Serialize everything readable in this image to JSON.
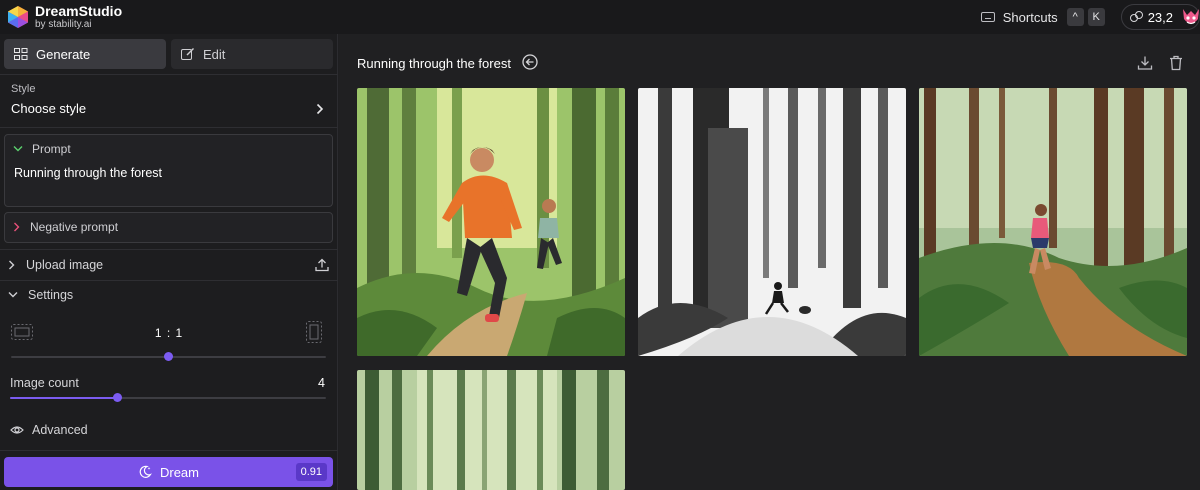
{
  "header": {
    "app_name": "DreamStudio",
    "app_sub": "by stability.ai",
    "shortcuts_label": "Shortcuts",
    "shortcut_keys": [
      "^",
      "K"
    ],
    "credits": "23,2"
  },
  "sidebar": {
    "tabs": [
      {
        "label": "Generate",
        "icon": "grid-icon",
        "active": true
      },
      {
        "label": "Edit",
        "icon": "edit-icon",
        "active": false
      }
    ],
    "style": {
      "label": "Style",
      "value": "Choose style"
    },
    "prompt": {
      "label": "Prompt",
      "text": "Running through the forest"
    },
    "negative_prompt": {
      "label": "Negative prompt"
    },
    "upload_image": {
      "label": "Upload image"
    },
    "settings": {
      "label": "Settings"
    },
    "aspect": {
      "ratio": "1 : 1",
      "slider_fraction": 0.5
    },
    "image_count": {
      "label": "Image count",
      "value": "4",
      "slider_fraction": 0.34
    },
    "advanced": {
      "label": "Advanced"
    },
    "dream_button": {
      "label": "Dream",
      "cost": "0.91"
    }
  },
  "main": {
    "title": "Running through the forest",
    "images": [
      {
        "description": "illustrated runners in orange jacket in forest"
      },
      {
        "description": "black and white sketch of runner in forest"
      },
      {
        "description": "woman jogging on forest trail"
      },
      {
        "description": "forest trees illustration"
      }
    ]
  },
  "colors": {
    "accent": "#7a52e8",
    "background": "#1f1f21",
    "sidebar": "#1d1d1f"
  }
}
